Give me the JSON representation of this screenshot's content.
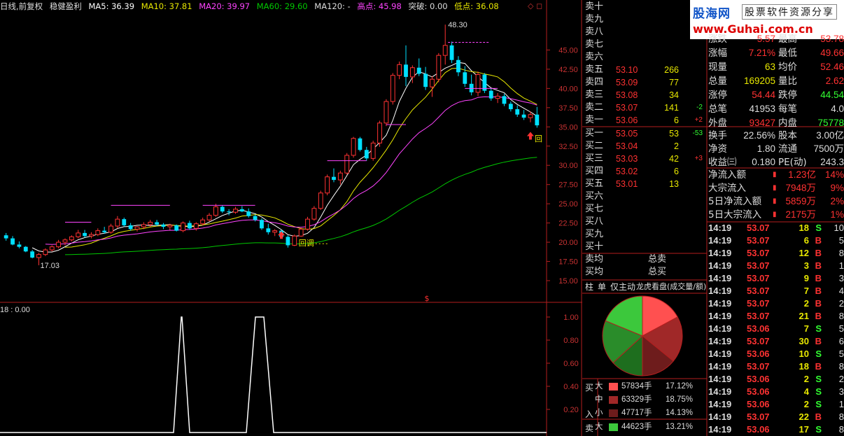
{
  "colors": {
    "up": "#ff3232",
    "down": "#00e0ff",
    "ma5": "#ffffff",
    "ma10": "#e8e800",
    "ma20": "#ff44ff",
    "ma60": "#00c800",
    "frame": "#b41e1e"
  },
  "header": {
    "title": "日线,前复权",
    "indicator": "稳健盈利",
    "ma5": "MA5: 36.39",
    "ma10": "MA10: 37.81",
    "ma20": "MA20: 39.97",
    "ma60": "MA60: 29.60",
    "ma120": "MA120: -",
    "high": "高点: 45.98",
    "breakout": "突破: 0.00",
    "low": "低点: 36.08",
    "icons": "◇ ◻"
  },
  "main_axis": [
    "45.00",
    "42.50",
    "40.00",
    "37.50",
    "35.00",
    "32.50",
    "30.00",
    "27.50",
    "25.00",
    "22.50",
    "20.00",
    "17.50",
    "15.00"
  ],
  "sub_axis": [
    "1.00",
    "0.80",
    "0.60",
    "0.40",
    "0.20"
  ],
  "annotations": {
    "peak": "48.30",
    "low_mark": "17.03",
    "callback1": "回调",
    "callback2": "回",
    "dollar": "$"
  },
  "sub_header": "18 : 0.00",
  "logo": {
    "brand": "股海网",
    "tagline": "股票软件资源分享",
    "url": "www.Guhai.com.cn"
  },
  "orderbook": {
    "sells": [
      {
        "label": "卖十",
        "price": "",
        "vol": "",
        "chg": ""
      },
      {
        "label": "卖九",
        "price": "",
        "vol": "",
        "chg": ""
      },
      {
        "label": "卖八",
        "price": "",
        "vol": "",
        "chg": ""
      },
      {
        "label": "卖七",
        "price": "",
        "vol": "",
        "chg": ""
      },
      {
        "label": "卖六",
        "price": "",
        "vol": "",
        "chg": ""
      },
      {
        "label": "卖五",
        "price": "53.10",
        "vol": "266",
        "chg": ""
      },
      {
        "label": "卖四",
        "price": "53.09",
        "vol": "77",
        "chg": ""
      },
      {
        "label": "卖三",
        "price": "53.08",
        "vol": "34",
        "chg": ""
      },
      {
        "label": "卖二",
        "price": "53.07",
        "vol": "141",
        "chg": "-2"
      },
      {
        "label": "卖一",
        "price": "53.06",
        "vol": "6",
        "chg": "+2"
      }
    ],
    "buys": [
      {
        "label": "买一",
        "price": "53.05",
        "vol": "53",
        "chg": "-53"
      },
      {
        "label": "买二",
        "price": "53.04",
        "vol": "2",
        "chg": ""
      },
      {
        "label": "买三",
        "price": "53.03",
        "vol": "42",
        "chg": "+3"
      },
      {
        "label": "买四",
        "price": "53.02",
        "vol": "6",
        "chg": ""
      },
      {
        "label": "买五",
        "price": "53.01",
        "vol": "13",
        "chg": ""
      },
      {
        "label": "买六",
        "price": "",
        "vol": "",
        "chg": ""
      },
      {
        "label": "买七",
        "price": "",
        "vol": "",
        "chg": ""
      },
      {
        "label": "买八",
        "price": "",
        "vol": "",
        "chg": ""
      },
      {
        "label": "买九",
        "price": "",
        "vol": "",
        "chg": ""
      },
      {
        "label": "买十",
        "price": "",
        "vol": "",
        "chg": ""
      }
    ],
    "avg_sell": "卖均",
    "avg_buy": "买均",
    "total_sell": "总卖",
    "total_buy": "总买"
  },
  "quote": [
    {
      "l1": "涨跌",
      "v1": "5.57",
      "l2": "最高",
      "v2": "53.78",
      "c1": "#ff3232",
      "c2": "#ff3232"
    },
    {
      "l1": "涨幅",
      "v1": "7.21%",
      "l2": "最低",
      "v2": "49.66",
      "c1": "#ff3232",
      "c2": "#ff3232"
    },
    {
      "l1": "现量",
      "v1": "63",
      "l2": "均价",
      "v2": "52.46",
      "c1": "#e8e800",
      "c2": "#ff3232"
    },
    {
      "l1": "总量",
      "v1": "169205",
      "l2": "量比",
      "v2": "2.62",
      "c1": "#e8e800",
      "c2": "#ff3232"
    },
    {
      "l1": "涨停",
      "v1": "54.44",
      "l2": "跌停",
      "v2": "44.54",
      "c1": "#ff3232",
      "c2": "#32ff32"
    },
    {
      "l1": "总笔",
      "v1": "41953",
      "l2": "每笔",
      "v2": "4.0",
      "c1": "#dddddd",
      "c2": "#dddddd"
    },
    {
      "l1": "外盘",
      "v1": "93427",
      "l2": "内盘",
      "v2": "75778",
      "c1": "#ff3232",
      "c2": "#32ff32"
    },
    {
      "l1": "换手",
      "v1": "22.56%",
      "l2": "股本",
      "v2": "3.00亿",
      "c1": "#dddddd",
      "c2": "#dddddd"
    },
    {
      "l1": "净资",
      "v1": "1.80",
      "l2": "流通",
      "v2": "7500万",
      "c1": "#dddddd",
      "c2": "#dddddd"
    },
    {
      "l1": "收益㈢",
      "v1": "0.180",
      "l2": "PE(动)",
      "v2": "243.3",
      "c1": "#dddddd",
      "c2": "#dddddd"
    }
  ],
  "flows": [
    {
      "label": "净流入额",
      "value": "1.23亿",
      "pct": "14%"
    },
    {
      "label": "大宗流入",
      "value": "7948万",
      "pct": "9%"
    },
    {
      "label": "5日净流入额",
      "value": "5859万",
      "pct": "2%"
    },
    {
      "label": "5日大宗流入",
      "value": "2175万",
      "pct": "1%"
    }
  ],
  "ticks": [
    {
      "time": "14:19",
      "price": "53.07",
      "vol": "18",
      "bs": "S",
      "n": "10",
      "vc": "#e8e800",
      "bc": "#32ff32"
    },
    {
      "time": "14:19",
      "price": "53.07",
      "vol": "6",
      "bs": "B",
      "n": "5",
      "vc": "#e8e800",
      "bc": "#ff3232"
    },
    {
      "time": "14:19",
      "price": "53.07",
      "vol": "12",
      "bs": "B",
      "n": "8",
      "vc": "#e8e800",
      "bc": "#ff3232"
    },
    {
      "time": "14:19",
      "price": "53.07",
      "vol": "3",
      "bs": "B",
      "n": "1",
      "vc": "#e8e800",
      "bc": "#ff3232"
    },
    {
      "time": "14:19",
      "price": "53.07",
      "vol": "9",
      "bs": "B",
      "n": "3",
      "vc": "#e8e800",
      "bc": "#ff3232"
    },
    {
      "time": "14:19",
      "price": "53.07",
      "vol": "7",
      "bs": "B",
      "n": "4",
      "vc": "#e8e800",
      "bc": "#ff3232"
    },
    {
      "time": "14:19",
      "price": "53.07",
      "vol": "2",
      "bs": "B",
      "n": "2",
      "vc": "#e8e800",
      "bc": "#ff3232"
    },
    {
      "time": "14:19",
      "price": "53.07",
      "vol": "21",
      "bs": "B",
      "n": "8",
      "vc": "#e8e800",
      "bc": "#ff3232"
    },
    {
      "time": "14:19",
      "price": "53.06",
      "vol": "7",
      "bs": "S",
      "n": "5",
      "vc": "#e8e800",
      "bc": "#32ff32"
    },
    {
      "time": "14:19",
      "price": "53.07",
      "vol": "30",
      "bs": "B",
      "n": "6",
      "vc": "#e8e800",
      "bc": "#ff3232"
    },
    {
      "time": "14:19",
      "price": "53.06",
      "vol": "10",
      "bs": "S",
      "n": "5",
      "vc": "#e8e800",
      "bc": "#32ff32"
    },
    {
      "time": "14:19",
      "price": "53.07",
      "vol": "18",
      "bs": "B",
      "n": "8",
      "vc": "#e8e800",
      "bc": "#ff3232"
    },
    {
      "time": "14:19",
      "price": "53.06",
      "vol": "2",
      "bs": "S",
      "n": "2",
      "vc": "#e8e800",
      "bc": "#32ff32"
    },
    {
      "time": "14:19",
      "price": "53.06",
      "vol": "4",
      "bs": "S",
      "n": "3",
      "vc": "#e8e800",
      "bc": "#32ff32"
    },
    {
      "time": "14:19",
      "price": "53.06",
      "vol": "2",
      "bs": "S",
      "n": "1",
      "vc": "#e8e800",
      "bc": "#32ff32"
    },
    {
      "time": "14:19",
      "price": "53.07",
      "vol": "22",
      "bs": "B",
      "n": "8",
      "vc": "#e8e800",
      "bc": "#ff3232"
    },
    {
      "time": "14:19",
      "price": "53.06",
      "vol": "17",
      "bs": "S",
      "n": "8",
      "vc": "#e8e800",
      "bc": "#32ff32"
    }
  ],
  "tabs": [
    "柱",
    "单",
    "仅主动",
    "龙虎看盘(成交量/额)"
  ],
  "fund_legend": {
    "buy_label": "买",
    "in_label": "入",
    "sell_label": "卖",
    "rows": [
      {
        "size": "大",
        "color": "#ff5050",
        "amount": "57834手",
        "pct": "17.12%"
      },
      {
        "size": "中",
        "color": "#a02828",
        "amount": "63329手",
        "pct": "18.75%"
      },
      {
        "size": "小",
        "color": "#6e1c1c",
        "amount": "47717手",
        "pct": "14.13%"
      },
      {
        "size": "大",
        "color": "#3cc83c",
        "amount": "44623手",
        "pct": "13.21%"
      }
    ]
  },
  "chart_data": {
    "type": "candlestick",
    "pie_fractions": [
      17.12,
      18.75,
      14.13,
      13.21,
      18.0,
      18.79
    ],
    "sub_indicator_peaks": [
      1.0,
      1.0
    ],
    "candles": [
      [
        20.9,
        21.2,
        20.2,
        20.5
      ],
      [
        20.5,
        20.8,
        19.6,
        19.7
      ],
      [
        19.7,
        20.1,
        19.2,
        19.4
      ],
      [
        19.4,
        19.5,
        18.7,
        18.8
      ],
      [
        18.8,
        19.0,
        17.9,
        18.0
      ],
      [
        18.0,
        18.6,
        17.0,
        18.4
      ],
      [
        18.4,
        19.2,
        18.2,
        19.0
      ],
      [
        19.0,
        19.6,
        18.8,
        19.4
      ],
      [
        19.4,
        20.3,
        19.2,
        20.0
      ],
      [
        20.0,
        20.5,
        19.6,
        20.3
      ],
      [
        20.3,
        20.9,
        20.1,
        20.7
      ],
      [
        20.7,
        21.6,
        20.5,
        21.2
      ],
      [
        21.2,
        21.6,
        20.6,
        20.8
      ],
      [
        20.8,
        21.3,
        20.5,
        21.0
      ],
      [
        21.0,
        21.8,
        20.8,
        21.5
      ],
      [
        21.5,
        22.0,
        21.1,
        21.3
      ],
      [
        21.3,
        22.4,
        21.1,
        22.1
      ],
      [
        22.1,
        23.4,
        21.8,
        23.0
      ],
      [
        23.0,
        23.2,
        22.0,
        22.2
      ],
      [
        22.2,
        22.5,
        21.5,
        21.7
      ],
      [
        21.7,
        22.1,
        21.4,
        22.0
      ],
      [
        22.0,
        22.6,
        21.7,
        22.3
      ],
      [
        22.3,
        22.9,
        22.0,
        22.6
      ],
      [
        22.6,
        22.9,
        22.1,
        22.3
      ],
      [
        22.3,
        22.5,
        21.7,
        22.0
      ],
      [
        22.0,
        22.4,
        21.6,
        22.2
      ],
      [
        22.2,
        22.3,
        21.4,
        21.5
      ],
      [
        21.5,
        22.7,
        21.3,
        22.5
      ],
      [
        22.5,
        22.8,
        21.6,
        21.8
      ],
      [
        21.8,
        22.6,
        21.5,
        22.4
      ],
      [
        22.4,
        23.2,
        22.2,
        22.9
      ],
      [
        22.9,
        23.8,
        22.7,
        23.5
      ],
      [
        23.5,
        25.0,
        23.3,
        24.6
      ],
      [
        24.6,
        24.8,
        23.8,
        24.0
      ],
      [
        24.0,
        24.3,
        23.5,
        23.9
      ],
      [
        23.9,
        24.6,
        23.7,
        24.3
      ],
      [
        24.3,
        24.7,
        23.9,
        24.0
      ],
      [
        24.0,
        24.4,
        23.2,
        23.4
      ],
      [
        23.4,
        23.6,
        22.7,
        22.9
      ],
      [
        22.9,
        23.1,
        21.6,
        21.8
      ],
      [
        21.8,
        22.4,
        21.0,
        21.3
      ],
      [
        21.3,
        21.7,
        20.8,
        21.5
      ],
      [
        21.5,
        21.6,
        20.6,
        20.7
      ],
      [
        20.7,
        20.9,
        19.3,
        19.6
      ],
      [
        19.6,
        21.0,
        19.5,
        20.8
      ],
      [
        20.8,
        21.9,
        20.7,
        21.7
      ],
      [
        21.7,
        23.3,
        21.5,
        23.0
      ],
      [
        23.0,
        24.7,
        22.8,
        24.4
      ],
      [
        24.4,
        26.7,
        24.2,
        26.4
      ],
      [
        26.4,
        28.8,
        26.1,
        28.5
      ],
      [
        28.5,
        29.6,
        27.8,
        28.1
      ],
      [
        28.1,
        29.3,
        27.5,
        29.0
      ],
      [
        29.0,
        31.6,
        28.8,
        31.3
      ],
      [
        31.3,
        33.7,
        31.0,
        33.5
      ],
      [
        33.5,
        33.7,
        31.8,
        32.0
      ],
      [
        32.0,
        32.4,
        30.6,
        30.9
      ],
      [
        30.9,
        33.2,
        30.6,
        32.9
      ],
      [
        32.9,
        35.8,
        32.4,
        35.5
      ],
      [
        35.5,
        38.6,
        35.1,
        38.3
      ],
      [
        38.3,
        42.0,
        37.9,
        41.7
      ],
      [
        41.7,
        43.5,
        41.2,
        43.1
      ],
      [
        43.1,
        45.6,
        40.3,
        41.5
      ],
      [
        41.5,
        43.0,
        40.7,
        42.7
      ],
      [
        42.7,
        43.9,
        41.6,
        41.9
      ],
      [
        41.9,
        42.8,
        39.8,
        40.2
      ],
      [
        40.2,
        41.6,
        38.9,
        41.2
      ],
      [
        41.2,
        44.6,
        40.8,
        44.3
      ],
      [
        44.3,
        48.3,
        43.1,
        45.6
      ],
      [
        45.6,
        46.1,
        43.3,
        43.7
      ],
      [
        43.7,
        44.2,
        41.6,
        42.1
      ],
      [
        42.1,
        42.9,
        40.2,
        40.6
      ],
      [
        40.6,
        41.8,
        39.1,
        39.5
      ],
      [
        39.5,
        42.2,
        39.0,
        41.8
      ],
      [
        41.8,
        42.0,
        39.4,
        39.7
      ],
      [
        39.7,
        40.0,
        38.4,
        38.7
      ],
      [
        38.7,
        39.4,
        38.1,
        39.0
      ],
      [
        39.0,
        39.3,
        37.7,
        38.0
      ],
      [
        38.0,
        38.3,
        37.0,
        37.3
      ],
      [
        37.3,
        37.8,
        36.3,
        36.6
      ],
      [
        36.6,
        37.2,
        35.9,
        36.2
      ],
      [
        36.2,
        37.0,
        35.6,
        36.6
      ],
      [
        36.6,
        37.6,
        34.9,
        35.2
      ]
    ],
    "ylim": [
      14.0,
      49.5
    ]
  }
}
